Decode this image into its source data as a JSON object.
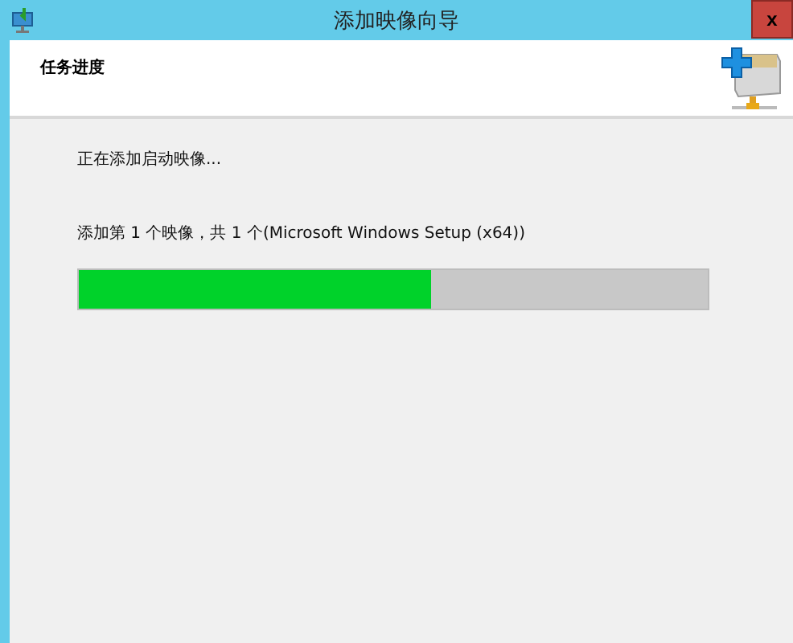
{
  "window": {
    "title": "添加映像向导",
    "close": "x"
  },
  "header": {
    "title": "任务进度"
  },
  "status": "正在添加启动映像...",
  "detail": "添加第 1 个映像，共 1 个(Microsoft Windows Setup (x64))",
  "progress": {
    "level": 0.56
  }
}
